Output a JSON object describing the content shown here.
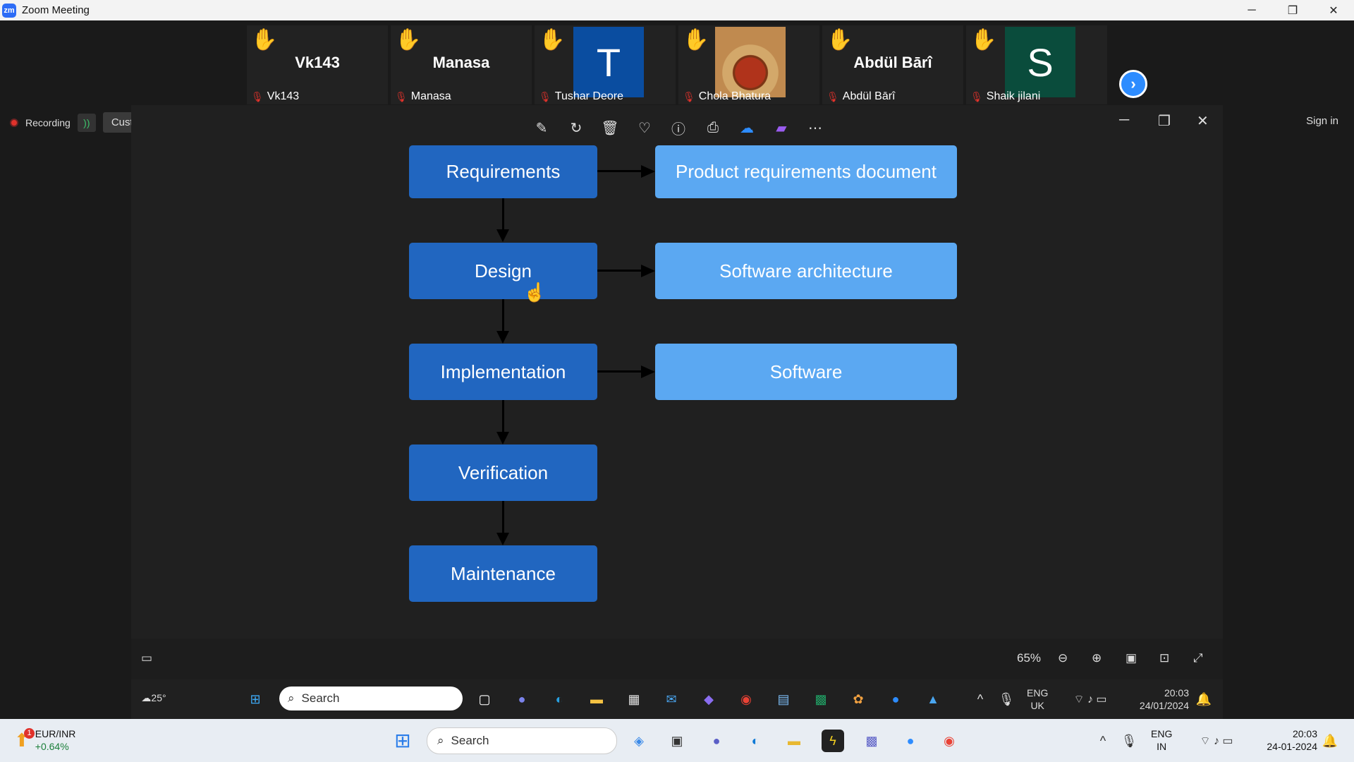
{
  "window": {
    "title": "Zoom Meeting",
    "logo": "zm"
  },
  "participants": [
    {
      "name": "Vk143",
      "display": "Vk143",
      "type": "text"
    },
    {
      "name": "Manasa",
      "display": "Manasa",
      "type": "text"
    },
    {
      "name": "Tushar Deore",
      "display": "T",
      "type": "avatar",
      "color": "#0a4da0"
    },
    {
      "name": "Chola Bhatura",
      "display": "",
      "type": "photo"
    },
    {
      "name": "Abdül Bārî",
      "display": "Abdül Bārî",
      "type": "text"
    },
    {
      "name": "Shaik jilani",
      "display": "S",
      "type": "avatar",
      "color": "#0a4c3c"
    }
  ],
  "recording": {
    "label": "Recording",
    "stream_label": "Custom Live Streaming Service"
  },
  "signin_label": "Sign in",
  "diagram": {
    "steps": [
      "Requirements",
      "Design",
      "Implementation",
      "Verification",
      "Maintenance"
    ],
    "outputs": [
      "Product requirements document",
      "Software architecture",
      "Software"
    ]
  },
  "viewer": {
    "zoom": "65%"
  },
  "inner_taskbar": {
    "weather": "25°",
    "search": "Search",
    "lang1": "ENG",
    "lang2": "UK",
    "time": "20:03",
    "date": "24/01/2024"
  },
  "taskbar": {
    "ticker": "EUR/INR",
    "ticker_change": "+0.64%",
    "ticker_badge": "1",
    "search": "Search",
    "lang1": "ENG",
    "lang2": "IN",
    "time": "20:03",
    "date": "24-01-2024"
  }
}
